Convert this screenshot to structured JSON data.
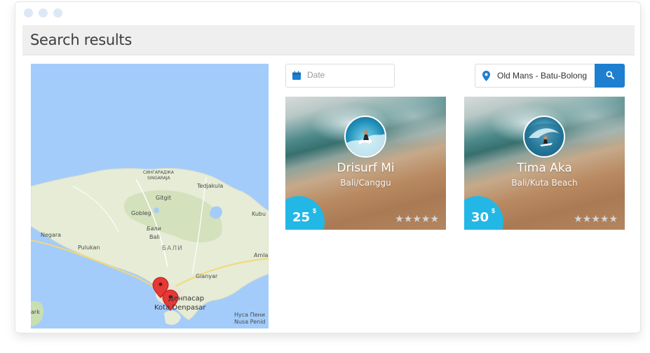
{
  "window": {
    "dots": 3
  },
  "header": {
    "title": "Search results"
  },
  "map": {
    "labels": {
      "singaraja_cyr": "СИНГАРАДЖА",
      "singaraja": "SINGARAJA",
      "tedjakula": "Tedjakula",
      "gitgit": "Gitgit",
      "gobleg": "Gobleg",
      "kubu": "Kubu",
      "negara": "Negara",
      "bali_italic": "Бали",
      "bali": "Bali",
      "bali_region": "БАЛИ",
      "pulukan": "Pulukan",
      "amla": "Amla",
      "gianyar": "Gianyar",
      "denpasar_cyr": "Денпасар",
      "denpasar": "Kota Denpasar",
      "nusa_cyr": "Нуса Пени",
      "nusa": "Nusa Penid",
      "park": "ark"
    }
  },
  "search": {
    "date_placeholder": "Date",
    "location_value": "Old Mans - Batu-Bolong",
    "icons": {
      "date": "calendar-icon",
      "location": "map-pin-icon",
      "search": "search-icon"
    }
  },
  "colors": {
    "accent": "#1d7fd0",
    "badge": "#23b7e5",
    "star": "#d6d6d6",
    "marker": "#e53935"
  },
  "results": [
    {
      "name": "Drisurf Mi",
      "location": "Bali/Canggu",
      "price": "25",
      "currency": "$",
      "rating": 5
    },
    {
      "name": "Tima Aka",
      "location": "Bali/Kuta Beach",
      "price": "30",
      "currency": "$",
      "rating": 5
    }
  ]
}
